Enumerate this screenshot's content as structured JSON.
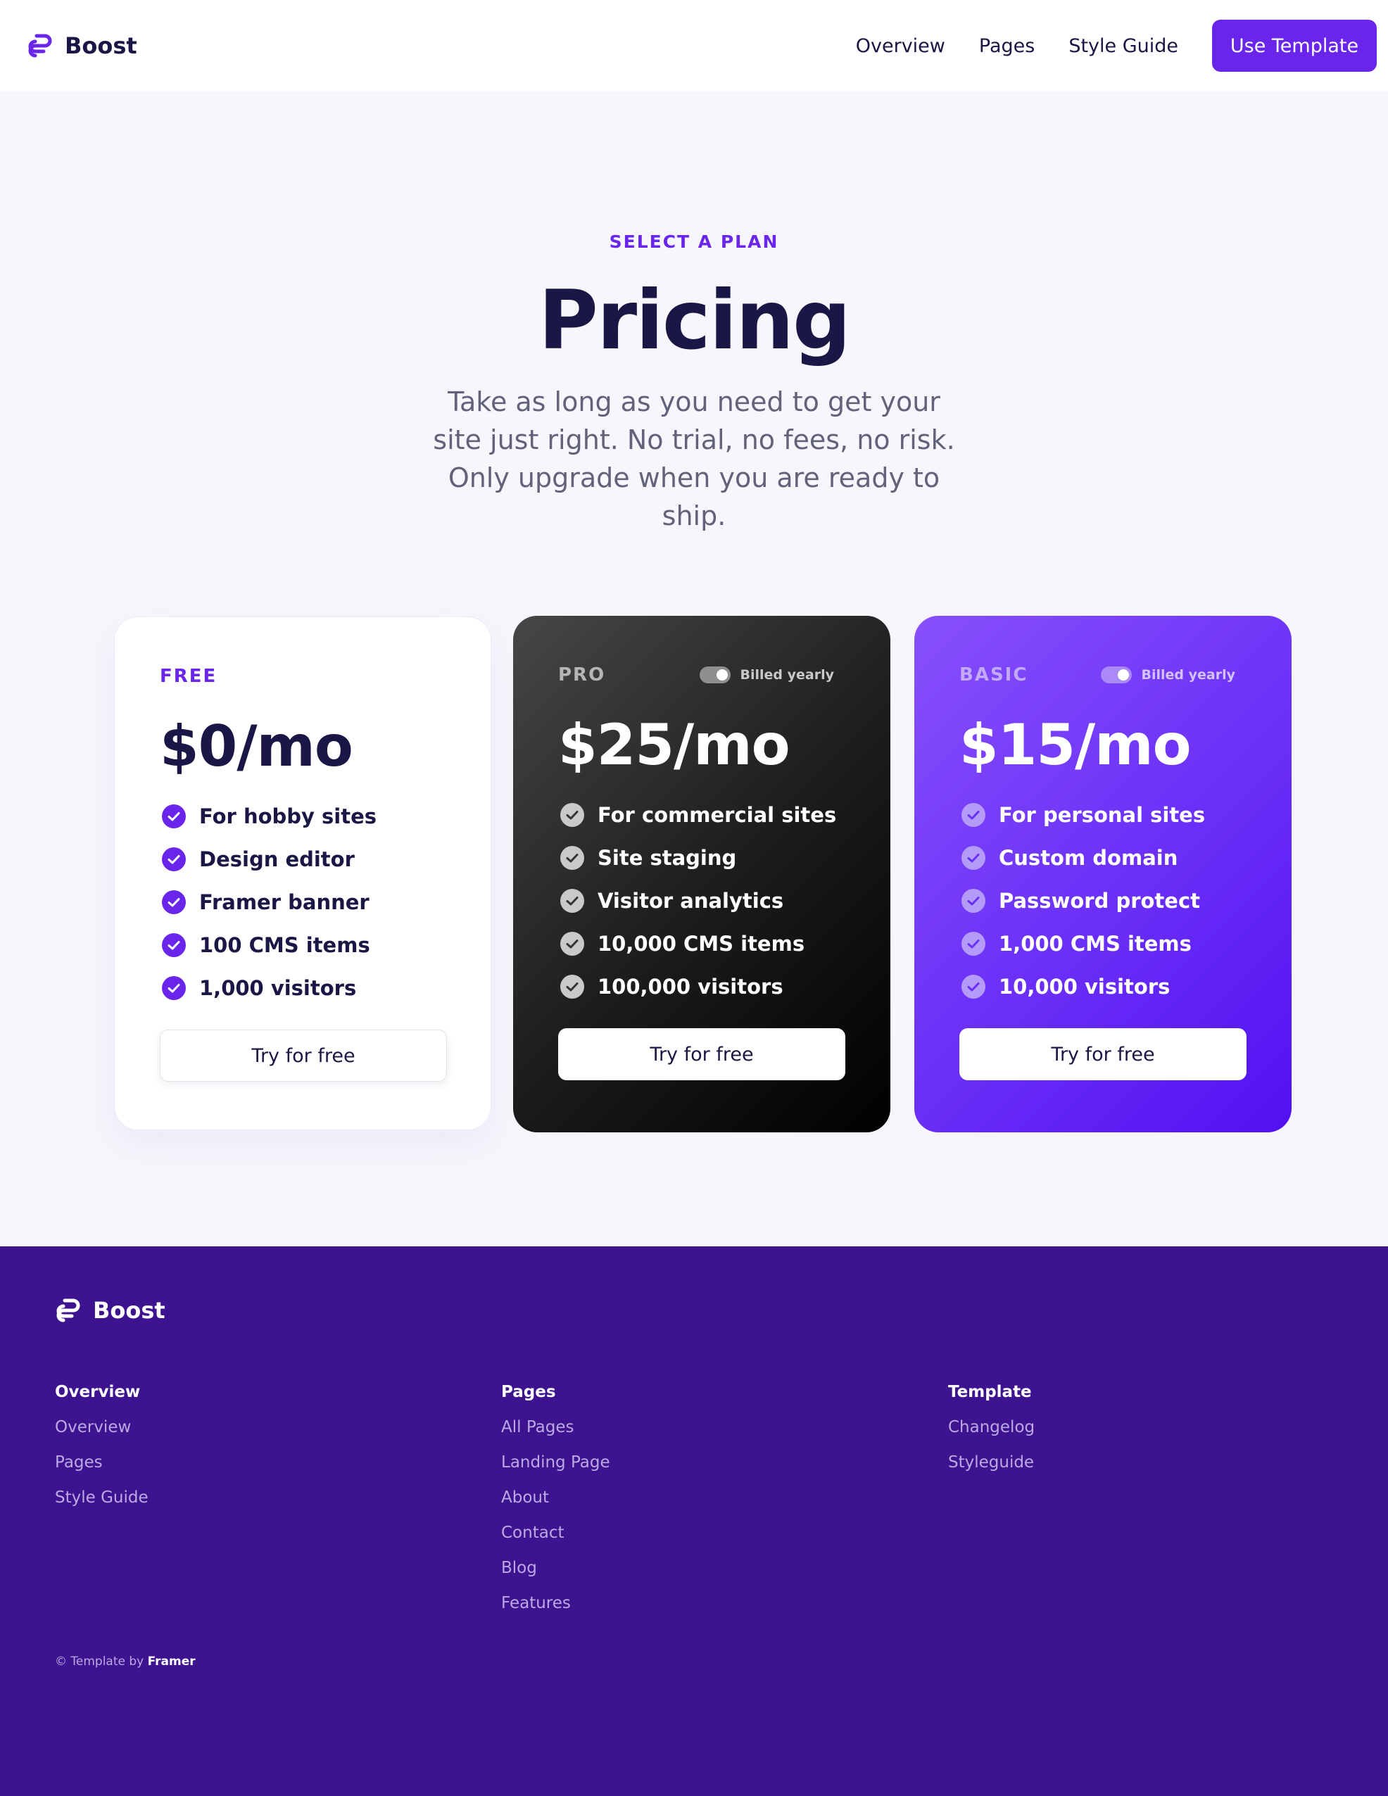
{
  "brand": {
    "name": "Boost",
    "accent_color": "#6a25ea",
    "dark_text_color": "#1a1645",
    "footer_bg": "#3e138f"
  },
  "nav": {
    "links": [
      "Overview",
      "Pages",
      "Style Guide"
    ],
    "cta_label": "Use Template"
  },
  "hero": {
    "eyebrow": "SELECT A PLAN",
    "title": "Pricing",
    "subtitle": "Take as long as you need to get your site just right. No trial, no fees, no risk. Only upgrade when you are ready to ship."
  },
  "plans": [
    {
      "name": "FREE",
      "price": "$0/mo",
      "features": [
        "For hobby sites",
        "Design editor",
        "Framer banner",
        "100 CMS items",
        "1,000 visitors"
      ],
      "button_label": "Try for free",
      "check_icon": "check-circle-icon"
    },
    {
      "name": "PRO",
      "billing_label": "Billed yearly",
      "billing_toggle_on": true,
      "price": "$25/mo",
      "features": [
        "For commercial sites",
        "Site staging",
        "Visitor analytics",
        "10,000 CMS items",
        "100,000 visitors"
      ],
      "button_label": "Try for free",
      "check_icon": "check-circle-icon"
    },
    {
      "name": "BASIC",
      "billing_label": "Billed yearly",
      "billing_toggle_on": true,
      "price": "$15/mo",
      "features": [
        "For personal sites",
        "Custom domain",
        "Password protect",
        "1,000 CMS items",
        "10,000 visitors"
      ],
      "button_label": "Try for free",
      "check_icon": "check-circle-icon"
    }
  ],
  "footer": {
    "brand_name": "Boost",
    "columns": [
      {
        "heading": "Overview",
        "links": [
          "Overview",
          "Pages",
          "Style Guide"
        ]
      },
      {
        "heading": "Pages",
        "links": [
          "All Pages",
          "Landing Page",
          "About",
          "Contact",
          "Blog",
          "Features"
        ]
      },
      {
        "heading": "Template",
        "links": [
          "Changelog",
          "Styleguide"
        ]
      }
    ],
    "copyright_prefix": "© Template by",
    "copyright_brand": "Framer"
  }
}
